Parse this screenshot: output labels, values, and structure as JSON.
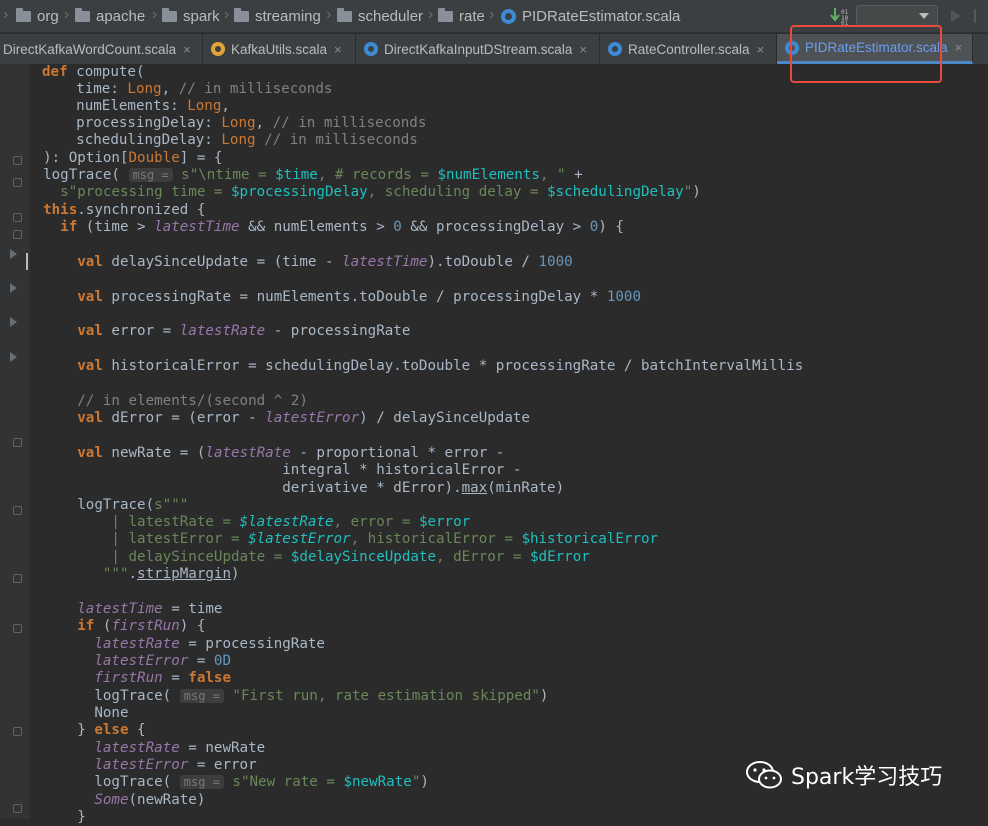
{
  "breadcrumb": [
    {
      "label": "org"
    },
    {
      "label": "apache"
    },
    {
      "label": "spark"
    },
    {
      "label": "streaming"
    },
    {
      "label": "scheduler"
    },
    {
      "label": "rate"
    },
    {
      "label": "PIDRateEstimator.scala"
    }
  ],
  "tabs": [
    {
      "label": "DirectKafkaWordCount.scala",
      "close": "×"
    },
    {
      "label": "KafkaUtils.scala",
      "close": "×"
    },
    {
      "label": "DirectKafkaInputDStream.scala",
      "close": "×"
    },
    {
      "label": "RateController.scala",
      "close": "×"
    },
    {
      "label": "PIDRateEstimator.scala",
      "close": "×",
      "active": true
    }
  ],
  "code": {
    "l1_kw": "def",
    "l1_fn": " compute(",
    "l2_a": "    time: ",
    "l2_t": "Long",
    "l2_b": ", ",
    "l2_c": "// in milliseconds",
    "l3_a": "    numElements: ",
    "l3_t": "Long",
    "l3_b": ",",
    "l4_a": "    processingDelay: ",
    "l4_t": "Long",
    "l4_b": ", ",
    "l4_c": "// in milliseconds",
    "l5_a": "    schedulingDelay: ",
    "l5_t": "Long",
    "l5_b": " ",
    "l5_c": "// in milliseconds",
    "l6_a": "  ): Option[",
    "l6_t": "Double",
    "l6_b": "] = {",
    "l7_a": "  logTrace( ",
    "l7_h": "msg =",
    "l7_s1": " s\"\\ntime = ",
    "l7_v1": "$time",
    "l7_s2": ", # records = ",
    "l7_v2": "$numElements",
    "l7_s3": ", \"",
    "l7_b": " +",
    "l8_s1": "    s\"processing time = ",
    "l8_v1": "$processingDelay",
    "l8_s2": ", scheduling delay = ",
    "l8_v2": "$schedulingDelay",
    "l8_s3": "\"",
    "l8_b": ")",
    "l9_kw": "  this",
    "l9_b": ".synchronized {",
    "l10_kw": "    if",
    "l10_a": " (time > ",
    "l10_f": "latestTime",
    "l10_b": " && numElements > ",
    "l10_n1": "0",
    "l10_c": " && processingDelay > ",
    "l10_n2": "0",
    "l10_d": ") {",
    "l11_kw": "      val",
    "l11_a": " delaySinceUpdate = (time - ",
    "l11_f": "latestTime",
    "l11_b": ").toDouble / ",
    "l11_n": "1000",
    "l12_kw": "      val",
    "l12_a": " processingRate = numElements.toDouble / processingDelay * ",
    "l12_n": "1000",
    "l13_kw": "      val",
    "l13_a": " error = ",
    "l13_f": "latestRate",
    "l13_b": " - processingRate",
    "l14_kw": "      val",
    "l14_a": " historicalError = schedulingDelay.toDouble * processingRate / batchIntervalMillis",
    "l15_c": "      // in elements/(second ^ 2)",
    "l16_kw": "      val",
    "l16_a": " dError = (error - ",
    "l16_f": "latestError",
    "l16_b": ") / delaySinceUpdate",
    "l17_kw": "      val",
    "l17_a": " newRate = (",
    "l17_f": "latestRate",
    "l17_b": " - proportional * error -",
    "l18_a": "                              integral * historicalError -",
    "l19_a": "                              derivative * dError).",
    "l19_u": "max",
    "l19_b": "(minRate)",
    "l20_a": "      logTrace(",
    "l20_s": "s\"\"\"",
    "l21_s1": "          | latestRate = ",
    "l21_v1": "$latestRate",
    "l21_s2": ", error = ",
    "l21_v2": "$error",
    "l22_s1": "          | latestError = ",
    "l22_v1": "$latestError",
    "l22_s2": ", historicalError = ",
    "l22_v2": "$historicalError",
    "l23_s1": "          | delaySinceUpdate = ",
    "l23_v1": "$delaySinceUpdate",
    "l23_s2": ", dError = ",
    "l23_v2": "$dError",
    "l24_s": "         \"\"\"",
    "l24_b": ".",
    "l24_u": "stripMargin",
    "l24_c": ")",
    "l25_f": "      latestTime",
    "l25_a": " = time",
    "l26_kw": "      if",
    "l26_a": " (",
    "l26_f": "firstRun",
    "l26_b": ") {",
    "l27_f": "        latestRate",
    "l27_a": " = processingRate",
    "l28_f": "        latestError",
    "l28_a": " = ",
    "l28_n": "0D",
    "l29_f": "        firstRun",
    "l29_a": " = ",
    "l29_kw": "false",
    "l30_a": "        logTrace( ",
    "l30_h": "msg =",
    "l30_s": " \"First run, rate estimation skipped\"",
    "l30_b": ")",
    "l31_a": "        None",
    "l32_a": "      } ",
    "l32_kw": "else",
    "l32_b": " {",
    "l33_f": "        latestRate",
    "l33_a": " = newRate",
    "l34_f": "        latestError",
    "l34_a": " = error",
    "l35_a": "        logTrace( ",
    "l35_h": "msg =",
    "l35_s1": " s\"New rate = ",
    "l35_v": "$newRate",
    "l35_s2": "\"",
    "l35_b": ")",
    "l36_f": "        Some",
    "l36_a": "(newRate)",
    "l37_a": "      }"
  },
  "watermark": {
    "text": "Spark学习技巧"
  },
  "colors": {
    "keyword": "#cc7832",
    "comment": "#808080",
    "string": "#6a8759",
    "number": "#6897bb",
    "field": "#9876aa",
    "interp": "#1fbfbf",
    "highlight_box": "#e74c3c"
  }
}
